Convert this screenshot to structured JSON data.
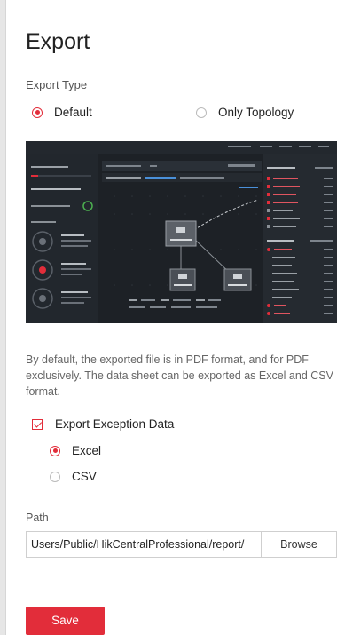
{
  "dialog": {
    "title": "Export",
    "export_type_label": "Export Type",
    "export_type_options": [
      {
        "label": "Default",
        "selected": true
      },
      {
        "label": "Only Topology",
        "selected": false
      }
    ],
    "description_lines": [
      "By default, the exported file is in PDF format, and for PDF",
      "exclusively. The data sheet can be exported as Excel and CSV",
      "format."
    ],
    "exception": {
      "label": "Export Exception Data",
      "checked": true
    },
    "format_options": [
      {
        "label": "Excel",
        "selected": true
      },
      {
        "label": "CSV",
        "selected": false
      }
    ],
    "path": {
      "label": "Path",
      "value": "Users/Public/HikCentralProfessional/report/",
      "browse_label": "Browse"
    },
    "save_label": "Save"
  },
  "colors": {
    "accent": "#e22d3a",
    "preview_bg": "#1d2126"
  }
}
